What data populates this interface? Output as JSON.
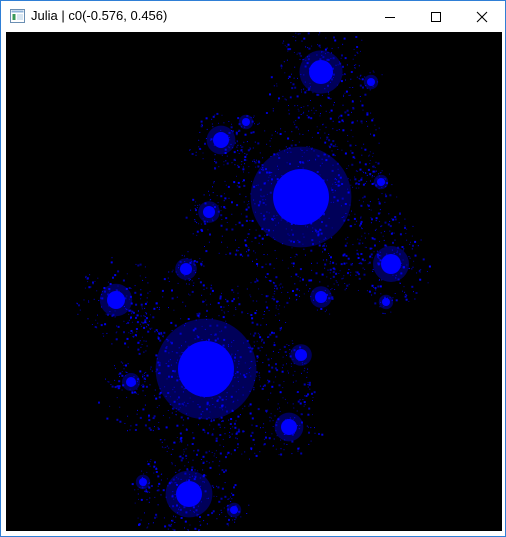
{
  "window": {
    "title": "Julia | c0(-0.576, 0.456)",
    "icon": "window-app-icon",
    "buttons": {
      "minimize": "minimize-icon",
      "maximize": "maximize-icon",
      "close": "close-icon"
    }
  },
  "canvas": {
    "background": "#000000",
    "fractal_color": "#0000ff"
  }
}
